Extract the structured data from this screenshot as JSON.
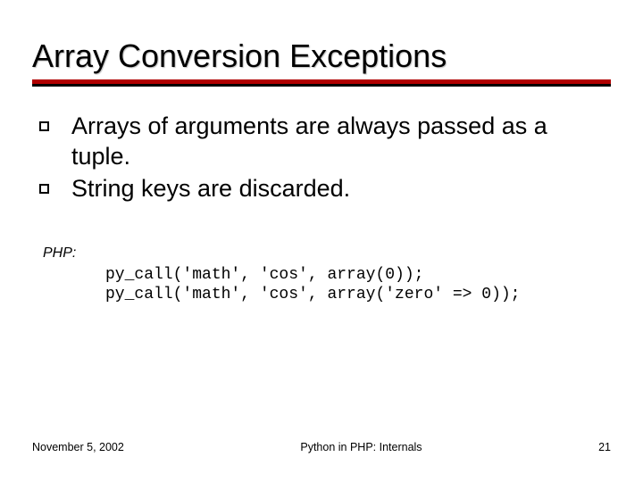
{
  "title": "Array Conversion Exceptions",
  "bullets": [
    {
      "text": "Arrays of arguments are always passed as a tuple."
    },
    {
      "text": "String keys are discarded."
    }
  ],
  "code": {
    "label": "PHP:",
    "lines": [
      "py_call('math', 'cos', array(0));",
      "py_call('math', 'cos', array('zero' => 0));"
    ]
  },
  "footer": {
    "date": "November 5, 2002",
    "center": "Python in PHP: Internals",
    "page": "21"
  }
}
